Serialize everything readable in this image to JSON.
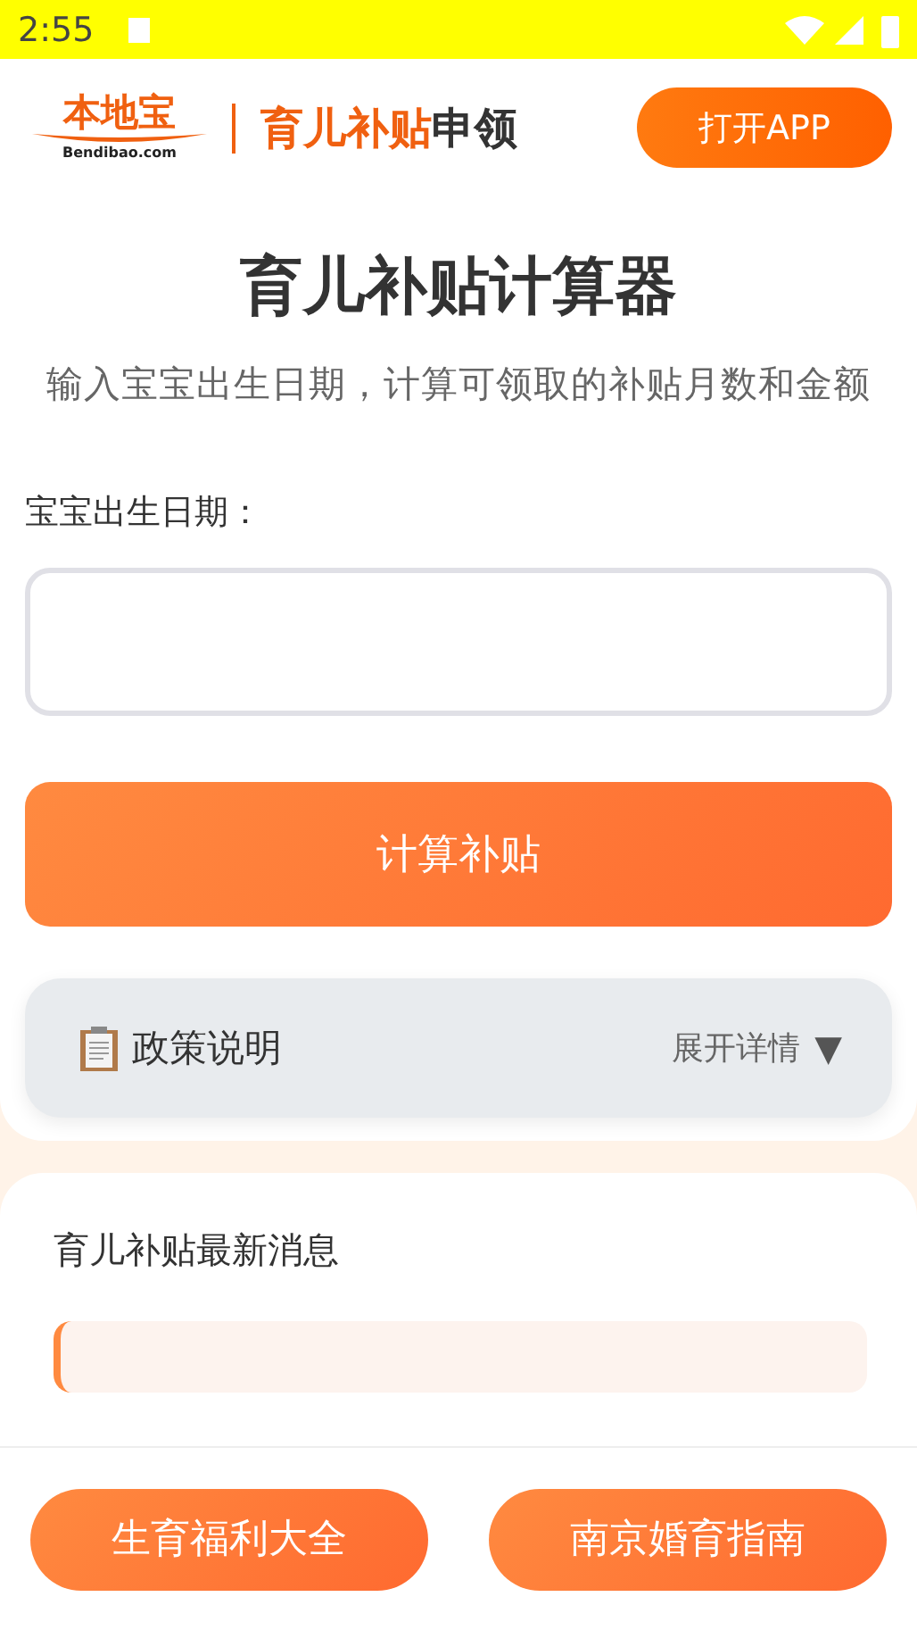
{
  "status_bar": {
    "time": "2:55"
  },
  "header": {
    "logo_text": "本地宝",
    "logo_domain": "Bendibao.com",
    "title_highlight": "育儿补贴",
    "title_rest": "申领",
    "open_app_button": "打开APP"
  },
  "calculator": {
    "title": "育儿补贴计算器",
    "subtitle": "输入宝宝出生日期，计算可领取的补贴月数和金额",
    "birth_date_label": "宝宝出生日期：",
    "calculate_button": "计算补贴"
  },
  "policy": {
    "title": "政策说明",
    "toggle": "展开详情",
    "toggle_arrow": "▼",
    "expanded": false
  },
  "news": {
    "title": "育儿补贴最新消息"
  },
  "bottom_buttons": [
    "生育福利大全",
    "南京婚育指南"
  ]
}
